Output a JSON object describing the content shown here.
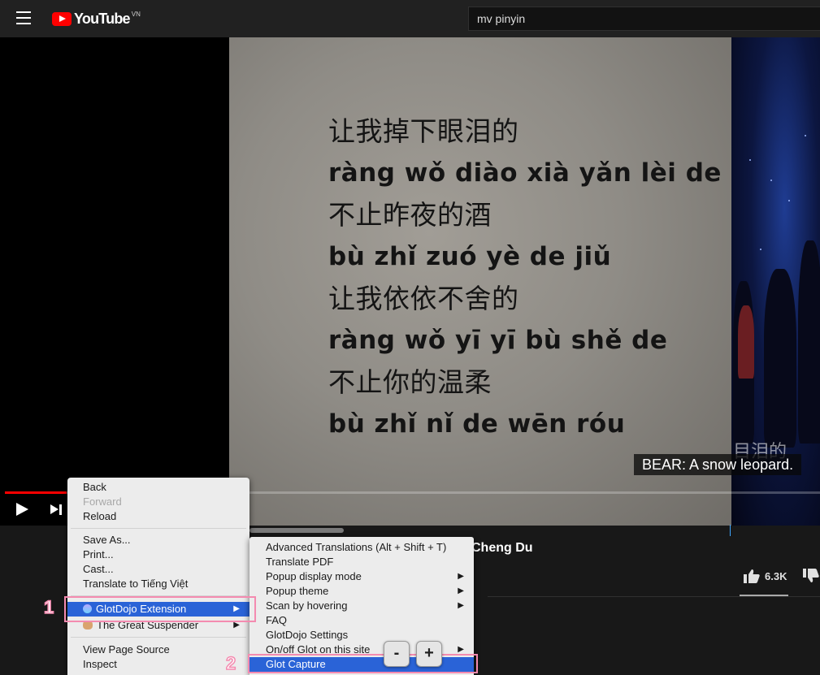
{
  "masthead": {
    "logo_text": "YouTube",
    "country_code": "VN",
    "search_value": "mv pinyin"
  },
  "video": {
    "lyrics": [
      {
        "text": "让我掉下眼泪的",
        "pinyin": false
      },
      {
        "text": "ràng wǒ diào xià yǎn lèi de",
        "pinyin": true
      },
      {
        "text": "不止昨夜的酒",
        "pinyin": false
      },
      {
        "text": "bù zhǐ zuó yè de jiǔ",
        "pinyin": true
      },
      {
        "text": "让我依依不舍的",
        "pinyin": false
      },
      {
        "text": "ràng wǒ yī yī bù shě de",
        "pinyin": true
      },
      {
        "text": "不止你的温柔",
        "pinyin": false
      },
      {
        "text": "bù zhǐ nǐ de wēn róu",
        "pinyin": true
      }
    ],
    "overlay_text": "目泪的",
    "caption": "BEAR: A snow leopard.",
    "progress_fraction": 0.075,
    "title_fragment": "Cheng Du",
    "like_count": "6.3K"
  },
  "context_menu": {
    "items": [
      {
        "label": "Back",
        "disabled": false
      },
      {
        "label": "Forward",
        "disabled": true
      },
      {
        "label": "Reload",
        "disabled": false
      },
      {
        "label": "Save As...",
        "disabled": false
      },
      {
        "label": "Print...",
        "disabled": false
      },
      {
        "label": "Cast...",
        "disabled": false
      },
      {
        "label": "Translate to Tiếng Việt",
        "disabled": false
      },
      {
        "label": "GlotDojo Extension",
        "disabled": false,
        "submenu": true,
        "selected": true
      },
      {
        "label": "The Great Suspender",
        "disabled": false,
        "submenu": true
      },
      {
        "label": "View Page Source",
        "disabled": false
      },
      {
        "label": "Inspect",
        "disabled": false
      }
    ],
    "submenu_arrow": "▶"
  },
  "glotdojo_submenu": {
    "items": [
      {
        "label": "Advanced Translations (Alt + Shift + T)"
      },
      {
        "label": "Translate PDF"
      },
      {
        "label": "Popup display mode",
        "submenu": true
      },
      {
        "label": "Popup theme",
        "submenu": true
      },
      {
        "label": "Scan by hovering",
        "submenu": true
      },
      {
        "label": "FAQ"
      },
      {
        "label": "GlotDojo Settings"
      },
      {
        "label": "On/off Glot on this site",
        "submenu": true
      },
      {
        "label": "Glot Capture",
        "selected": true
      }
    ]
  },
  "annotations": {
    "step1": "1",
    "step2": "2",
    "zoom_out": "-",
    "zoom_in": "+"
  },
  "colors": {
    "masthead": "#212121",
    "youtube_red": "#ff0000",
    "menu_bg": "#ececec",
    "menu_highlight": "#2a63d7",
    "annotation_pink": "#f48bb0"
  }
}
